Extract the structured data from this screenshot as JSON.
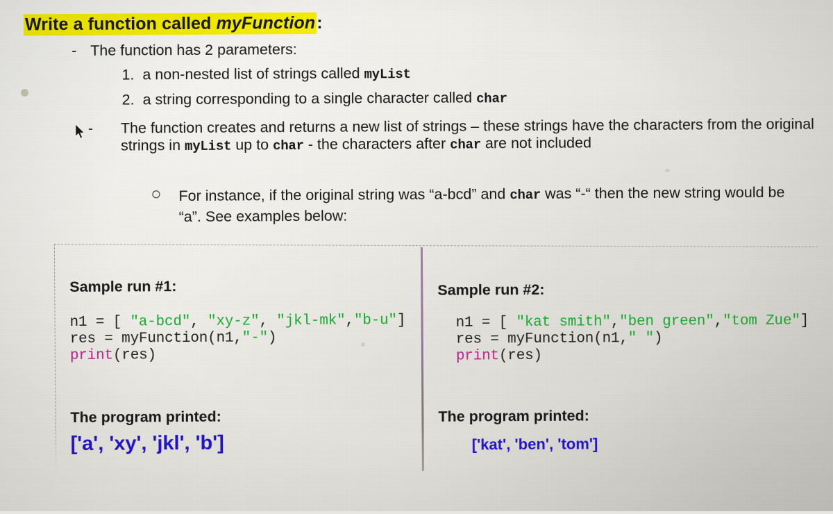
{
  "document": {
    "title_prefix": "Write a function called ",
    "title_function_name": "myFunction",
    "title_colon": ":",
    "bullet_parameters": "The function has 2 parameters:",
    "param_markers": [
      "1.",
      "2."
    ],
    "param_1_text_a": "a non-nested list of strings called ",
    "param_1_code": "myList",
    "param_2_text_a": "a string corresponding to a single character called ",
    "param_2_code": "char",
    "returns_para": {
      "part1": "The function creates and returns a new list of strings – these strings have the characters from the original strings in ",
      "code1": "myList",
      "part2": " up to ",
      "code2": "char",
      "part3": " - the characters after ",
      "code3": "char",
      "part4": " are not included"
    },
    "instance_para": {
      "part1": "For instance, if the original string was “a-bcd” and ",
      "code1": "char",
      "part2": " was “-“ then the new string would be “a”. See examples below:"
    },
    "dash_marker": "-"
  },
  "samples": [
    {
      "heading": "Sample run #1:",
      "code_lines": [
        [
          {
            "t": "n1 = [ ",
            "c": "plain"
          },
          {
            "t": "\"a-bcd\"",
            "c": "green"
          },
          {
            "t": ", ",
            "c": "plain"
          },
          {
            "t": "\"xy-z\"",
            "c": "green"
          },
          {
            "t": ", ",
            "c": "plain"
          },
          {
            "t": "\"jkl-mk\"",
            "c": "green"
          },
          {
            "t": ",",
            "c": "plain"
          },
          {
            "t": "\"b-u\"",
            "c": "green"
          },
          {
            "t": "]",
            "c": "plain"
          }
        ],
        [
          {
            "t": "res = myFunction(n1,",
            "c": "plain"
          },
          {
            "t": "\"-\"",
            "c": "green"
          },
          {
            "t": ")",
            "c": "plain"
          }
        ],
        [
          {
            "t": "print",
            "c": "print"
          },
          {
            "t": "(res)",
            "c": "plain"
          }
        ]
      ],
      "printed_label": "The program printed:",
      "printed_output": "['a', 'xy', 'jkl', 'b']"
    },
    {
      "heading": "Sample run #2:",
      "code_lines": [
        [
          {
            "t": "n1 = [ ",
            "c": "plain"
          },
          {
            "t": "\"kat smith\"",
            "c": "green"
          },
          {
            "t": ",",
            "c": "plain"
          },
          {
            "t": "\"ben green\"",
            "c": "green"
          },
          {
            "t": ",",
            "c": "plain"
          },
          {
            "t": "\"tom Zue\"",
            "c": "green"
          },
          {
            "t": "]",
            "c": "plain"
          }
        ],
        [
          {
            "t": "res = myFunction(n1,",
            "c": "plain"
          },
          {
            "t": "\" \"",
            "c": "green"
          },
          {
            "t": ")",
            "c": "plain"
          }
        ],
        [
          {
            "t": "print",
            "c": "print"
          },
          {
            "t": "(res)",
            "c": "plain"
          }
        ]
      ],
      "printed_label": "The program printed:",
      "printed_output": "['kat', 'ben', 'tom']"
    }
  ],
  "colors": {
    "highlight": "#f2ea00",
    "string_green": "#1aa831",
    "print_magenta": "#b8238e",
    "output_blue": "#2417c9",
    "divider_purple": "#7d6590",
    "paper": "#e9e7e1"
  },
  "icons": {
    "cursor": "mouse-cursor-icon",
    "bullet_circle": "circle-bullet-icon"
  }
}
